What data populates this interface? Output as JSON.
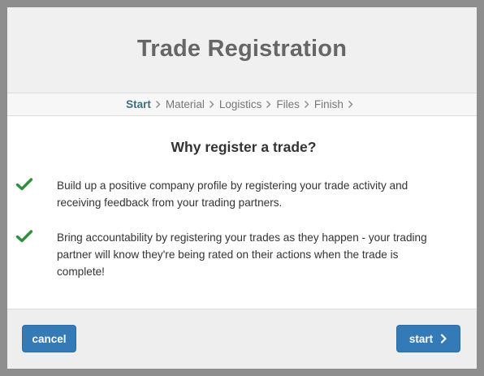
{
  "dialog": {
    "title": "Trade Registration",
    "steps": [
      {
        "label": "Start",
        "active": true
      },
      {
        "label": "Material",
        "active": false
      },
      {
        "label": "Logistics",
        "active": false
      },
      {
        "label": "Files",
        "active": false
      },
      {
        "label": "Finish",
        "active": false
      }
    ],
    "heading": "Why register a trade?",
    "reasons": [
      {
        "icon": "check-icon",
        "text": "Build up a positive company profile by registering your trade activity and receiving feedback from your trading partners."
      },
      {
        "icon": "check-icon",
        "text": "Bring accountability by registering your trades as they happen - your trading partner will know they're being rated on their actions when the trade is complete!"
      }
    ],
    "buttons": {
      "cancel_label": "cancel",
      "start_label": "start",
      "start_icon": "chevron-right-icon"
    }
  },
  "colors": {
    "backdrop": "#8e8e8e",
    "header_bg": "#f0f0f0",
    "active_step": "#3d6f84",
    "check": "#2f8f3a",
    "primary_button": "#337ab7"
  }
}
